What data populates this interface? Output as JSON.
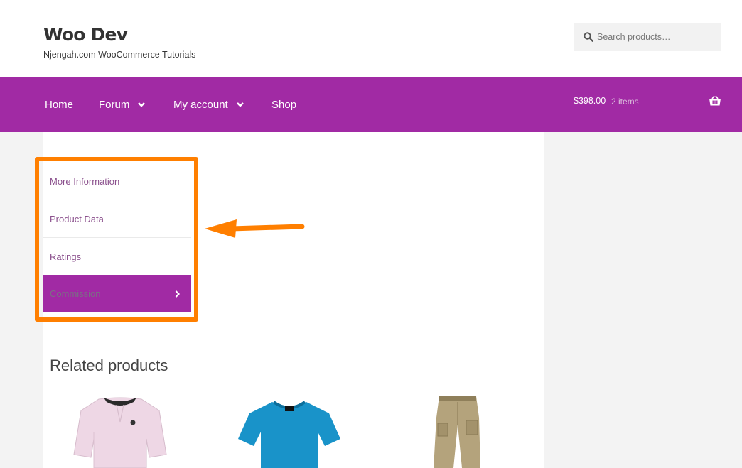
{
  "header": {
    "site_title": "Woo Dev",
    "tagline": "Njengah.com WooCommerce Tutorials",
    "search_placeholder": "Search products…"
  },
  "nav": {
    "items": [
      {
        "label": "Home",
        "has_dropdown": false
      },
      {
        "label": "Forum",
        "has_dropdown": true
      },
      {
        "label": "My account",
        "has_dropdown": true
      },
      {
        "label": "Shop",
        "has_dropdown": false
      }
    ],
    "cart_amount": "$398.00",
    "cart_items": "2 items",
    "icon": "basket-icon"
  },
  "tabs": [
    {
      "label": "More Information",
      "active": false
    },
    {
      "label": "Product Data",
      "active": false
    },
    {
      "label": "Ratings",
      "active": false
    },
    {
      "label": "Commission",
      "active": true
    }
  ],
  "related": {
    "heading": "Related products",
    "products": [
      {
        "image": "pink-polo-shirt"
      },
      {
        "image": "blue-t-shirt"
      },
      {
        "image": "khaki-cargo-pants"
      }
    ]
  },
  "colors": {
    "brand": "#a12aa4",
    "highlight": "#ff7f00",
    "tab_link": "#8a4f8c"
  }
}
